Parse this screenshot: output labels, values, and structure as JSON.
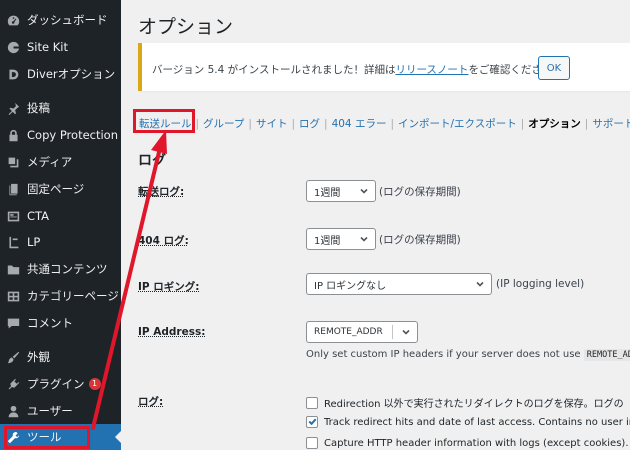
{
  "sidebar": {
    "items": [
      {
        "label": "ダッシュボード",
        "icon": "dashboard-icon"
      },
      {
        "label": "Site Kit",
        "icon": "google-g-icon"
      },
      {
        "label": "Diverオプション",
        "icon": "diver-icon"
      },
      {
        "label": "投稿",
        "icon": "pin-icon"
      },
      {
        "label": "Copy Protection",
        "icon": "lock-icon"
      },
      {
        "label": "メディア",
        "icon": "media-icon"
      },
      {
        "label": "固定ページ",
        "icon": "page-icon"
      },
      {
        "label": "CTA",
        "icon": "cta-icon"
      },
      {
        "label": "LP",
        "icon": "lp-icon"
      },
      {
        "label": "共通コンテンツ",
        "icon": "folder-icon"
      },
      {
        "label": "カテゴリーページ",
        "icon": "grid-icon"
      },
      {
        "label": "コメント",
        "icon": "comment-icon"
      },
      {
        "label": "外観",
        "icon": "brush-icon"
      },
      {
        "label": "プラグイン",
        "icon": "plugin-icon",
        "badge": "1"
      },
      {
        "label": "ユーザー",
        "icon": "user-icon"
      },
      {
        "label": "ツール",
        "icon": "wrench-icon",
        "active": true
      }
    ]
  },
  "header": {
    "title": "オプション"
  },
  "notice": {
    "text_before": "バージョン 5.4 がインストールされました！詳細は",
    "link": "リリースノート",
    "text_after": "をご確認ください。",
    "ok_label": "OK"
  },
  "subnav": {
    "items": [
      {
        "label": "転送ルール"
      },
      {
        "label": "グループ"
      },
      {
        "label": "サイト"
      },
      {
        "label": "ログ"
      },
      {
        "label": "404 エラー"
      },
      {
        "label": "インポート/エクスポート"
      },
      {
        "label": "オプション",
        "current": true
      },
      {
        "label": "サポート"
      }
    ],
    "separator": "|"
  },
  "section": {
    "title": "ログ"
  },
  "form": {
    "redirect_log": {
      "label": "転送ログ:",
      "value": "1週間",
      "hint": "(ログの保存期間)"
    },
    "log_404": {
      "label": "404 ログ:",
      "value": "1週間",
      "hint": "(ログの保存期間)"
    },
    "ip_logging": {
      "label": "IP ロギング:",
      "value": "IP ロギングなし",
      "hint": "(IP logging level)"
    },
    "ip_address": {
      "label": "IP Address:",
      "value": "REMOTE_ADDR",
      "desc": "Only set custom IP headers if your server does not use",
      "desc_code": "REMOTE_ADDR"
    },
    "log_options": {
      "label": "ログ:",
      "checks": [
        {
          "text": "Redirection 以外で実行されたリダイレクトのログを保存。ログの",
          "checked": false
        },
        {
          "text": "Track redirect hits and date of last access. Contains no user inform",
          "checked": true
        },
        {
          "text": "Capture HTTP header information with logs (except cookies). It m",
          "checked": false
        }
      ]
    }
  },
  "colors": {
    "sidebar_bg": "#1d2327",
    "active": "#2271b1",
    "link": "#2271b1",
    "notice_border": "#dba617",
    "annotation": "#e0162b",
    "badge": "#d63638"
  }
}
